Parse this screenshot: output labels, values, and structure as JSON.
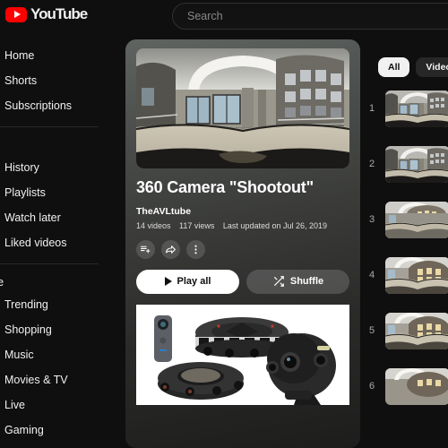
{
  "app": {
    "name": "YouTube",
    "logo_text": "YouTube",
    "background": "#0f0f0f",
    "brand_color": "#ff0000"
  },
  "search": {
    "placeholder": "Search"
  },
  "sidebar": {
    "primary": [
      {
        "label": "Home",
        "icon": "home-icon"
      },
      {
        "label": "Shorts",
        "icon": "shorts-icon"
      },
      {
        "label": "Subscriptions",
        "icon": "subscriptions-icon"
      }
    ],
    "you_label": "",
    "you_chevron": "›",
    "you_items": [
      {
        "label": "History",
        "icon": "history-icon"
      },
      {
        "label": "Playlists",
        "icon": "playlists-icon"
      },
      {
        "label": "Watch later",
        "icon": "clock-icon"
      },
      {
        "label": "Liked videos",
        "icon": "thumbs-up-icon"
      }
    ],
    "explore_header": "re",
    "explore_items": [
      {
        "label": "Trending",
        "icon": "trending-icon"
      },
      {
        "label": "Shopping",
        "icon": "shopping-icon"
      },
      {
        "label": "Music",
        "icon": "music-icon"
      },
      {
        "label": "Movies & TV",
        "icon": "movies-icon"
      },
      {
        "label": "Live",
        "icon": "live-icon"
      },
      {
        "label": "Gaming",
        "icon": "gaming-icon"
      }
    ]
  },
  "playlist": {
    "title": "360 Camera \"Shootout\"",
    "channel": "TheAVLtube",
    "video_count": "14 videos",
    "views": "117 views",
    "updated": "Last updated on Jul 26, 2019",
    "actions": [
      {
        "name": "save-to-playlist",
        "icon": "playlist-add-icon"
      },
      {
        "name": "share",
        "icon": "share-icon"
      },
      {
        "name": "more-options",
        "icon": "more-vertical-icon"
      }
    ],
    "play_all_label": "Play all",
    "shuffle_label": "Shuffle",
    "thumbnail_alt": "360 equirectangular panorama of a building atrium interior",
    "product_image_alt": "Four 360-degree cameras on white background"
  },
  "filters": {
    "chips": [
      {
        "label": "All",
        "selected": true
      },
      {
        "label": "Videos",
        "selected": false
      }
    ]
  },
  "video_list": {
    "items": [
      {
        "index": "1"
      },
      {
        "index": "2"
      },
      {
        "index": "3"
      },
      {
        "index": "4"
      },
      {
        "index": "5"
      },
      {
        "index": "6"
      }
    ]
  }
}
